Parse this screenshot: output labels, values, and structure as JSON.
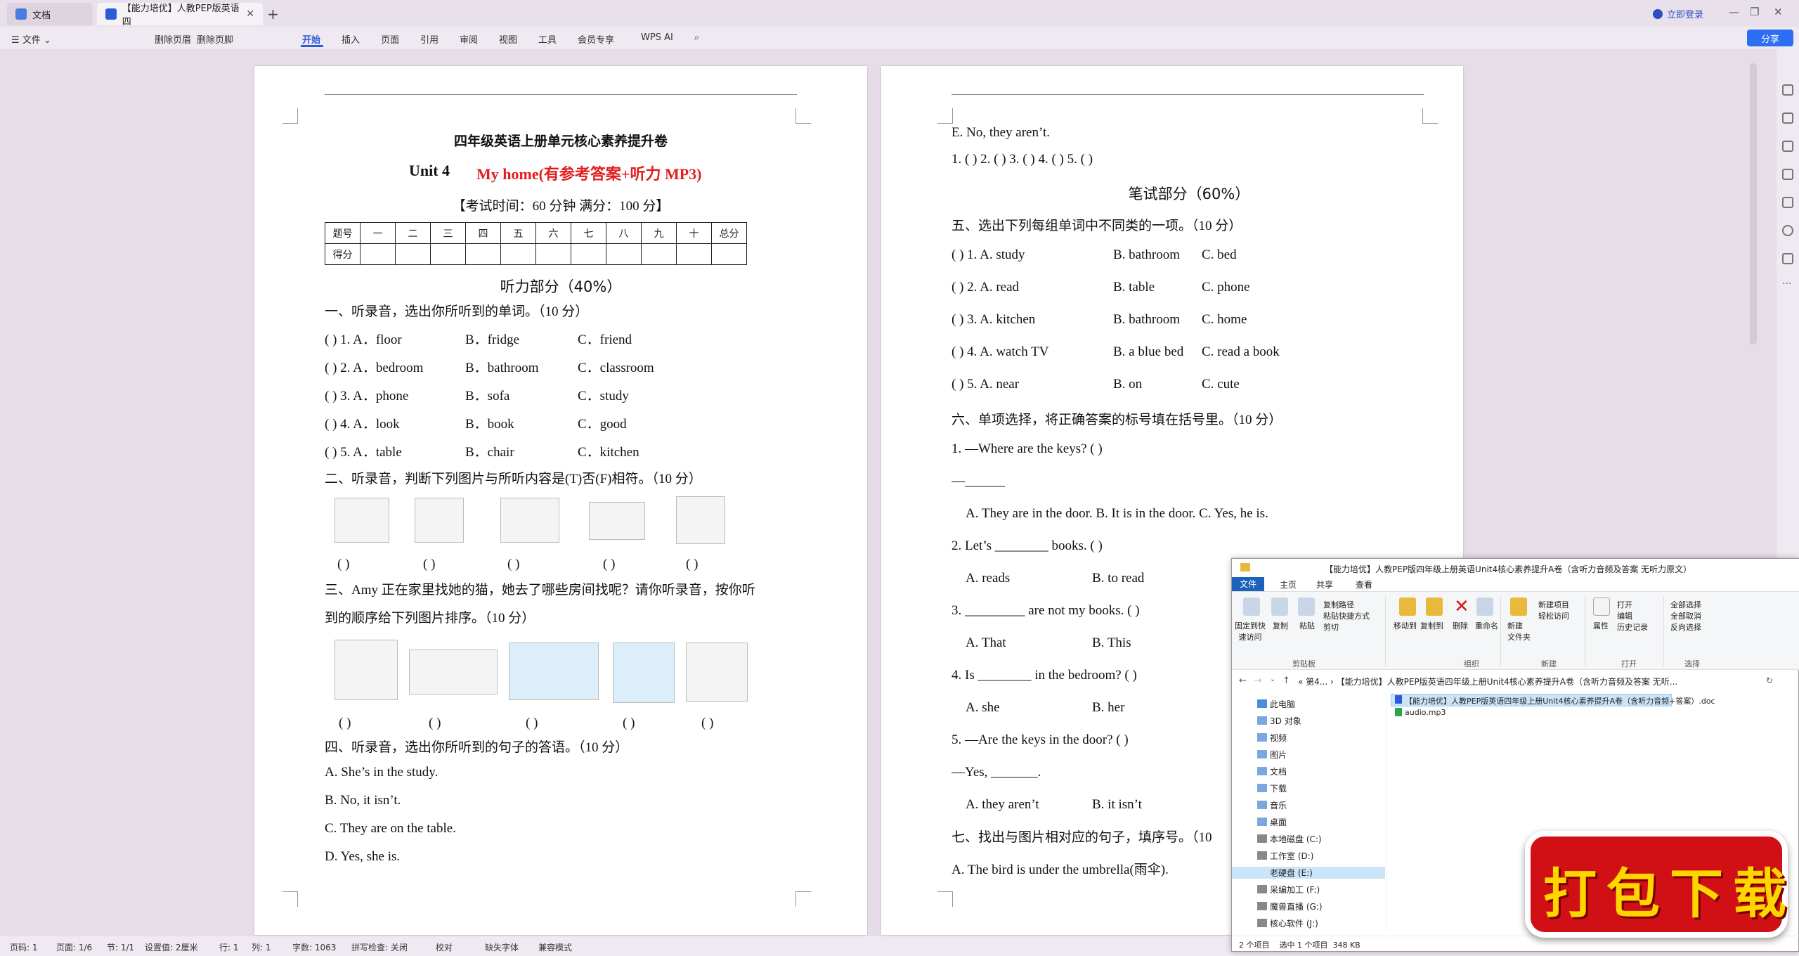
{
  "titlebar": {
    "tab1": "文档",
    "tab2": "【能力培优】人教PEP版英语四",
    "login": "立即登录"
  },
  "menu": {
    "file": "文件",
    "undo_items": [
      "删除页眉",
      "删除页脚"
    ],
    "tabs": [
      "开始",
      "插入",
      "页面",
      "引用",
      "审阅",
      "视图",
      "工具",
      "会员专享"
    ],
    "wps_ai": "WPS AI",
    "share": "分享"
  },
  "page1": {
    "title": "四年级英语上册单元核心素养提升卷",
    "unit": "Unit 4",
    "unit_title": "My home(有参考答案+听力 MP3)",
    "exam_info": "【考试时间：60 分钟  满分：100 分】",
    "score_header": [
      "题号",
      "一",
      "二",
      "三",
      "四",
      "五",
      "六",
      "七",
      "八",
      "九",
      "十",
      "总分"
    ],
    "score_row": "得分",
    "listening": "听力部分（40%）",
    "q1": "一、听录音，选出你所听到的单词。（10 分）",
    "q1_items": [
      [
        "(        ) 1. A．floor",
        "B．fridge",
        "C．friend"
      ],
      [
        "(        ) 2. A．bedroom",
        "B．bathroom",
        "C．classroom"
      ],
      [
        "(        ) 3. A．phone",
        "B．sofa",
        "C．study"
      ],
      [
        "(        ) 4. A．look",
        "B．book",
        "C．good"
      ],
      [
        "(        ) 5. A．table",
        "B．chair",
        "C．kitchen"
      ]
    ],
    "q2": "二、听录音，判断下列图片与所听内容是(T)否(F)相符。（10 分）",
    "paren": "(        )",
    "q3a": "三、Amy 正在家里找她的猫，她去了哪些房间找呢？请你听录音，按你听",
    "q3b": "到的顺序给下列图片排序。（10 分）",
    "q4": "四、听录音，选出你所听到的句子的答语。（10 分）",
    "q4_items": [
      "A.   She’s in the study.",
      "B.   No, it isn’t.",
      "C.   They are on the table.",
      "D.   Yes, she is."
    ]
  },
  "page2": {
    "e_item": "E.   No, they aren’t.",
    "answer_line": "1. (         )  2. (         )  3. (         )  4. (         )  5. (         )",
    "writing": "笔试部分（60%）",
    "q5": "五、选出下列每组单词中不同类的一项。（10 分）",
    "q5_items": [
      [
        "(        ) 1.  A.  study",
        "B.  bathroom",
        "C.  bed"
      ],
      [
        "(        ) 2.  A.  read",
        "B.  table",
        "C.  phone"
      ],
      [
        "(        ) 3.  A.  kitchen",
        "B.  bathroom",
        "C.  home"
      ],
      [
        "(        ) 4.  A.  watch TV",
        "B.  a blue bed",
        "C.  read a book"
      ],
      [
        "(        ) 5.  A.  near",
        "B.  on",
        "C.  cute"
      ]
    ],
    "q6": "六、单项选择，将正确答案的标号填在括号里。（10 分）",
    "q6_lines": [
      "1.     —Where are the keys? (        )",
      "—______",
      "A.  They are in the door.    B.  It is in the door.    C.  Yes, he is.",
      "2.     Let’s ________ books. (        )",
      "A.  reads",
      "B.  to read",
      "3.     _________ are not my books. (        )",
      "A.  That",
      "B.  This",
      "4.     Is ________ in the bedroom? (        )",
      "A.  she",
      "B.  her",
      "5.     —Are the keys in the door? (        )",
      "—Yes, _______.",
      "A.  they aren’t",
      "B.  it isn’t"
    ],
    "q7": "七、找出与图片相对应的句子，填序号。（10",
    "q7_a": "A.  The bird is under the umbrella(雨伞)."
  },
  "statusbar": [
    "页码: 1",
    "页面: 1/6",
    "节: 1/1",
    "设置值: 2厘米",
    "行: 1",
    "列: 1",
    "字数: 1063",
    "拼写检查: 关闭",
    "校对",
    "缺失字体",
    "兼容模式"
  ],
  "explorer": {
    "title": "【能力培优】人教PEP版四年级上册英语Unit4核心素养提升A卷（含听力音频及答案 无听力原文）",
    "tabs": [
      "文件",
      "主页",
      "共享",
      "查看"
    ],
    "ribbon": {
      "pin": "固定到快\n速访问",
      "copy": "复制",
      "paste": "粘贴",
      "copy_path": "复制路径",
      "paste_shortcut": "粘贴快捷方式",
      "cut": "剪切",
      "move_to": "移动到",
      "copy_to": "复制到",
      "delete": "删除",
      "rename": "重命名",
      "new_folder": "新建\n文件夹",
      "new_item": "新建项目",
      "easy_access": "轻松访问",
      "properties": "属性",
      "open": "打开",
      "edit": "编辑",
      "history": "历史记录",
      "select_all": "全部选择",
      "select_none": "全部取消",
      "invert": "反向选择",
      "groups": [
        "剪贴板",
        "组织",
        "新建",
        "打开",
        "选择"
      ]
    },
    "address": "«  第4...  ›  【能力培优】人教PEP版英语四年级上册Unit4核心素养提升A卷（含听力音频及答案 无听...",
    "nav": [
      "此电脑",
      "3D 对象",
      "视频",
      "图片",
      "文档",
      "下载",
      "音乐",
      "桌面",
      "本地磁盘 (C:)",
      "工作室 (D:)",
      "老硬盘 (E:)",
      "采编加工 (F:)",
      "魔兽直播 (G:)",
      "核心软件 (J:)"
    ],
    "files": [
      "【能力培优】人教PEP版英语四年级上册Unit4核心素养提升A卷（含听力音频+答案）.doc",
      "audio.mp3"
    ],
    "status": "2 个项目    选中 1 个项目  348 KB"
  },
  "download_badge": "打包下载"
}
